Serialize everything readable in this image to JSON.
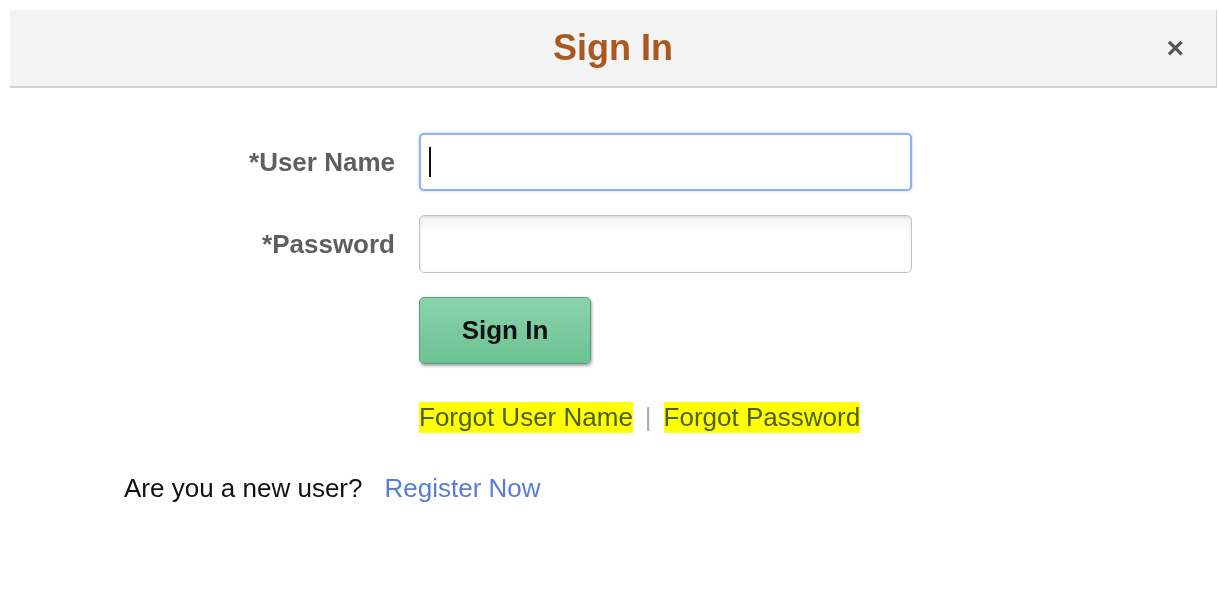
{
  "dialog": {
    "title": "Sign In",
    "close": "×"
  },
  "fields": [
    {
      "label": "*User Name",
      "focused": true
    },
    {
      "label": "*Password",
      "focused": false
    }
  ],
  "sign_in_button": "Sign In",
  "help_links": [
    {
      "text": "Forgot User Name",
      "highlighted": true
    },
    {
      "text": "Forgot Password",
      "highlighted": true
    }
  ],
  "separator": "|",
  "register": {
    "prompt": "Are you a new user?",
    "link": "Register Now"
  }
}
